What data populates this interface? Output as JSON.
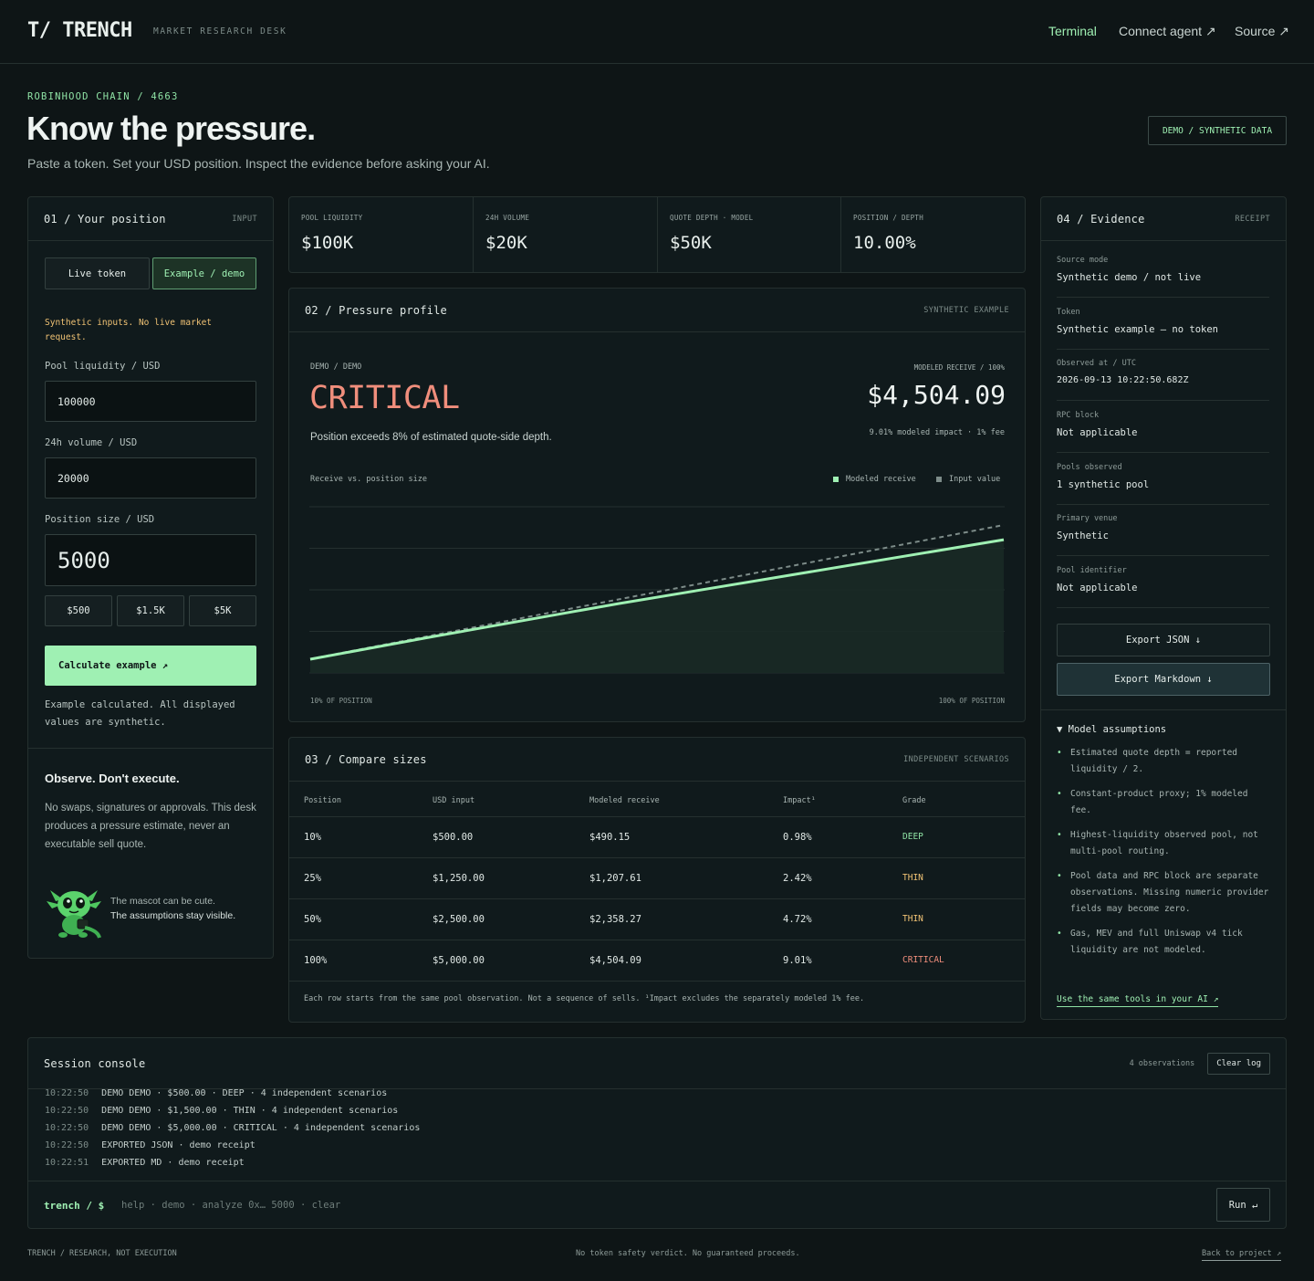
{
  "header": {
    "logo": "T/ TRENCH",
    "subtitle": "MARKET RESEARCH DESK",
    "nav": [
      {
        "label": "Terminal"
      },
      {
        "label": "Connect agent ↗"
      },
      {
        "label": "Source ↗"
      }
    ]
  },
  "hero": {
    "eyebrow": "ROBINHOOD CHAIN / 4663",
    "title": "Know the pressure.",
    "subtitle": "Paste a token. Set your USD position. Inspect the evidence before asking your AI.",
    "badge": "DEMO / SYNTHETIC DATA"
  },
  "position": {
    "title": "01 / Your position",
    "tag": "INPUT",
    "mode_live": "Live token",
    "mode_demo": "Example / demo",
    "notice": "Synthetic inputs. No live market request.",
    "liquidity_label": "Pool liquidity / USD",
    "liquidity_value": "100000",
    "volume_label": "24h volume / USD",
    "volume_value": "20000",
    "size_label": "Position size / USD",
    "size_value": "5000",
    "presets": [
      "$500",
      "$1.5K",
      "$5K"
    ],
    "calc_button": "Calculate example ↗",
    "status": "Example calculated. All displayed values are synthetic.",
    "observe_title": "Observe. Don't execute.",
    "observe_text": "No swaps, signatures or approvals. This desk produces a pressure estimate, never an executable sell quote.",
    "mascot_line1": "The mascot can be cute.",
    "mascot_line2": "The assumptions stay visible."
  },
  "stats": [
    {
      "label": "POOL LIQUIDITY",
      "value": "$100K"
    },
    {
      "label": "24H VOLUME",
      "value": "$20K"
    },
    {
      "label": "QUOTE DEPTH · MODEL",
      "value": "$50K"
    },
    {
      "label": "POSITION / DEPTH",
      "value": "10.00%"
    }
  ],
  "profile": {
    "title": "02 / Pressure profile",
    "tag": "SYNTHETIC EXAMPLE",
    "mode": "DEMO / DEMO",
    "grade": "CRITICAL",
    "description": "Position exceeds 8% of estimated quote-side depth.",
    "receive_label": "MODELED RECEIVE / 100%",
    "receive_value": "$4,504.09",
    "receive_note": "9.01% modeled impact · 1% fee",
    "chart_title": "Receive vs. position size",
    "legend_receive": "Modeled receive",
    "legend_input": "Input value",
    "x_min_label": "10% OF POSITION",
    "x_max_label": "100% OF POSITION",
    "colors": {
      "receive": "#9ff0b3",
      "input": "#7d8c89",
      "critical": "#f08e7c"
    }
  },
  "chart_data": {
    "type": "line",
    "title": "Receive vs. position size",
    "xlabel": "",
    "ylabel": "",
    "x": [
      10,
      25,
      50,
      100
    ],
    "series": [
      {
        "name": "Modeled receive",
        "values": [
          490.15,
          1207.61,
          2358.27,
          4504.09
        ]
      },
      {
        "name": "Input value",
        "values": [
          500,
          1250,
          2500,
          5000
        ]
      }
    ],
    "xlim": [
      10,
      100
    ],
    "ylim": [
      0,
      5000
    ],
    "grid": true,
    "legend": "top-right"
  },
  "compare": {
    "title": "03 / Compare sizes",
    "tag": "INDEPENDENT SCENARIOS",
    "headers": [
      "Position",
      "USD input",
      "Modeled receive",
      "Impact¹",
      "Grade"
    ],
    "rows": [
      {
        "position": "10%",
        "input": "$500.00",
        "receive": "$490.15",
        "impact": "0.98%",
        "grade": "DEEP",
        "color": "#8fe3a5"
      },
      {
        "position": "25%",
        "input": "$1,250.00",
        "receive": "$1,207.61",
        "impact": "2.42%",
        "grade": "THIN",
        "color": "#f0c274"
      },
      {
        "position": "50%",
        "input": "$2,500.00",
        "receive": "$2,358.27",
        "impact": "4.72%",
        "grade": "THIN",
        "color": "#f0c274"
      },
      {
        "position": "100%",
        "input": "$5,000.00",
        "receive": "$4,504.09",
        "impact": "9.01%",
        "grade": "CRITICAL",
        "color": "#f08e7c"
      }
    ],
    "footnote": "Each row starts from the same pool observation. Not a sequence of sells. ¹Impact excludes the separately modeled 1% fee."
  },
  "evidence": {
    "title": "04 / Evidence",
    "tag": "RECEIPT",
    "items": [
      {
        "label": "Source mode",
        "value": "Synthetic demo / not live"
      },
      {
        "label": "Token",
        "value": "Synthetic example — no token"
      },
      {
        "label": "Observed at / UTC",
        "value": "2026-09-13 10:22:50.682Z"
      },
      {
        "label": "RPC block",
        "value": "Not applicable"
      },
      {
        "label": "Pools observed",
        "value": "1 synthetic pool"
      },
      {
        "label": "Primary venue",
        "value": "Synthetic"
      },
      {
        "label": "Pool identifier",
        "value": "Not applicable"
      }
    ],
    "export_json": "Export JSON ↓",
    "export_md": "Export Markdown ↓",
    "assumptions_title": "▼ Model assumptions",
    "assumptions": [
      "Estimated quote depth = reported liquidity / 2.",
      "Constant-product proxy; 1% modeled fee.",
      "Highest-liquidity observed pool, not multi-pool routing.",
      "Pool data and RPC block are separate observations. Missing numeric provider fields may become zero.",
      "Gas, MEV and full Uniswap v4 tick liquidity are not modeled."
    ],
    "ai_link": "Use the same tools in your AI ↗"
  },
  "console": {
    "title": "Session console",
    "count": "4 observations",
    "clear": "Clear log",
    "lines": [
      {
        "time": "10:22:50",
        "text": "DEMO DEMO · $500.00 · DEEP · 4 independent scenarios"
      },
      {
        "time": "10:22:50",
        "text": "DEMO DEMO · $1,500.00 · THIN · 4 independent scenarios"
      },
      {
        "time": "10:22:50",
        "text": "DEMO DEMO · $5,000.00 · CRITICAL · 4 independent scenarios"
      },
      {
        "time": "10:22:50",
        "text": "EXPORTED JSON · demo receipt"
      },
      {
        "time": "10:22:51",
        "text": "EXPORTED MD · demo receipt"
      }
    ],
    "prompt": "trench / $",
    "placeholder": "help · demo · analyze 0x… 5000 · clear",
    "run": "Run ↵"
  },
  "footer": {
    "left": "TRENCH / RESEARCH, NOT EXECUTION",
    "center": "No token safety verdict. No guaranteed proceeds.",
    "right": "Back to project ↗"
  }
}
